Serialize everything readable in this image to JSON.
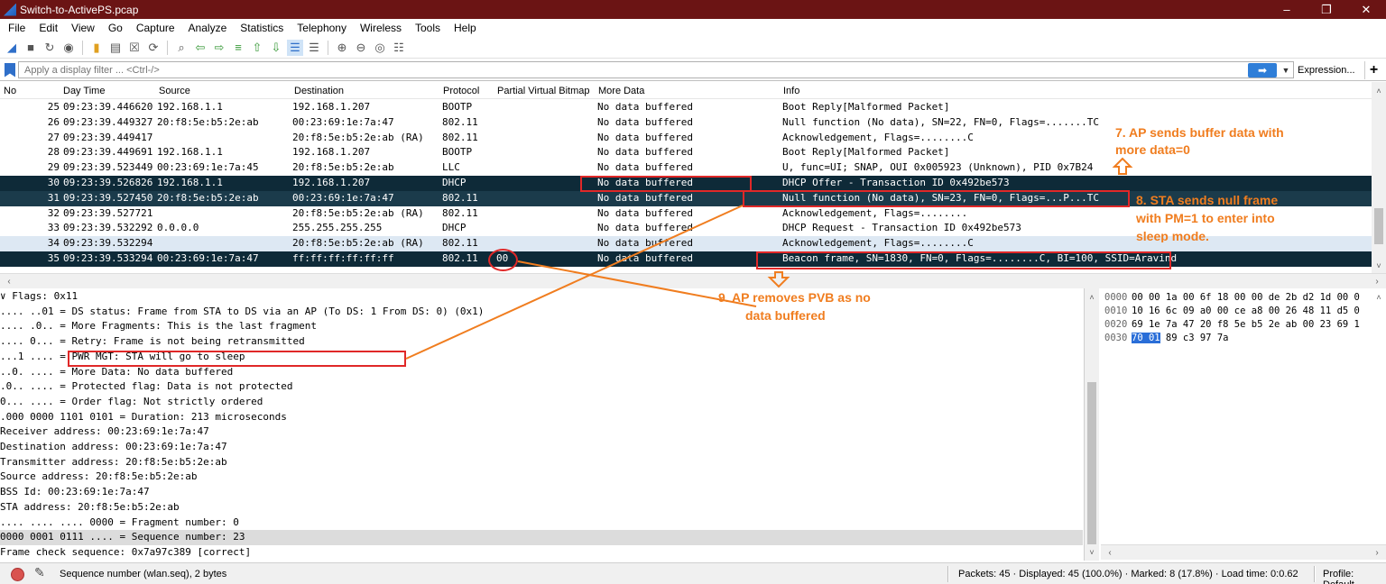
{
  "window": {
    "title": "Switch-to-ActivePS.pcap",
    "min_icon": "minimize-icon",
    "max_icon": "maximize-icon",
    "close_icon": "close-icon"
  },
  "menu": [
    "File",
    "Edit",
    "View",
    "Go",
    "Capture",
    "Analyze",
    "Statistics",
    "Telephony",
    "Wireless",
    "Tools",
    "Help"
  ],
  "filter": {
    "placeholder": "Apply a display filter ... <Ctrl-/>",
    "expression_label": "Expression...",
    "plus_label": "+"
  },
  "columns": {
    "no": "No",
    "time": "Day Time",
    "source": "Source",
    "destination": "Destination",
    "protocol": "Protocol",
    "pvb": "Partial Virtual Bitmap",
    "more_data": "More Data",
    "info": "Info"
  },
  "packets": [
    {
      "no": "25",
      "time": "09:23:39.446620",
      "source": "192.168.1.1",
      "destination": "192.168.1.207",
      "protocol": "BOOTP",
      "pvb": "",
      "more_data": "No data buffered",
      "info": "Boot Reply[Malformed Packet]"
    },
    {
      "no": "26",
      "time": "09:23:39.449327",
      "source": "20:f8:5e:b5:2e:ab",
      "destination": "00:23:69:1e:7a:47",
      "protocol": "802.11",
      "pvb": "",
      "more_data": "No data buffered",
      "info": "Null function (No data), SN=22, FN=0, Flags=.......TC"
    },
    {
      "no": "27",
      "time": "09:23:39.449417",
      "source": "",
      "destination": "20:f8:5e:b5:2e:ab (RA)",
      "protocol": "802.11",
      "pvb": "",
      "more_data": "No data buffered",
      "info": "Acknowledgement, Flags=........C"
    },
    {
      "no": "28",
      "time": "09:23:39.449691",
      "source": "192.168.1.1",
      "destination": "192.168.1.207",
      "protocol": "BOOTP",
      "pvb": "",
      "more_data": "No data buffered",
      "info": "Boot Reply[Malformed Packet]"
    },
    {
      "no": "29",
      "time": "09:23:39.523449",
      "source": "00:23:69:1e:7a:45",
      "destination": "20:f8:5e:b5:2e:ab",
      "protocol": "LLC",
      "pvb": "",
      "more_data": "No data buffered",
      "info": "U, func=UI; SNAP, OUI 0x005923 (Unknown), PID 0x7B24"
    },
    {
      "no": "30",
      "time": "09:23:39.526826",
      "source": "192.168.1.1",
      "destination": "192.168.1.207",
      "protocol": "DHCP",
      "pvb": "",
      "more_data": "No data buffered",
      "info": "DHCP Offer    - Transaction ID 0x492be573"
    },
    {
      "no": "31",
      "time": "09:23:39.527450",
      "source": "20:f8:5e:b5:2e:ab",
      "destination": "00:23:69:1e:7a:47",
      "protocol": "802.11",
      "pvb": "",
      "more_data": "No data buffered",
      "info": "Null function (No data), SN=23, FN=0, Flags=...P...TC"
    },
    {
      "no": "32",
      "time": "09:23:39.527721",
      "source": "",
      "destination": "20:f8:5e:b5:2e:ab (RA)",
      "protocol": "802.11",
      "pvb": "",
      "more_data": "No data buffered",
      "info": "Acknowledgement, Flags=........"
    },
    {
      "no": "33",
      "time": "09:23:39.532292",
      "source": "0.0.0.0",
      "destination": "255.255.255.255",
      "protocol": "DHCP",
      "pvb": "",
      "more_data": "No data buffered",
      "info": "DHCP Request  - Transaction ID 0x492be573"
    },
    {
      "no": "34",
      "time": "09:23:39.532294",
      "source": "",
      "destination": "20:f8:5e:b5:2e:ab (RA)",
      "protocol": "802.11",
      "pvb": "",
      "more_data": "No data buffered",
      "info": "Acknowledgement, Flags=........C"
    },
    {
      "no": "35",
      "time": "09:23:39.533294",
      "source": "00:23:69:1e:7a:47",
      "destination": "ff:ff:ff:ff:ff:ff",
      "protocol": "802.11",
      "pvb": "00",
      "more_data": "No data buffered",
      "info": "Beacon frame, SN=1830, FN=0, Flags=........C, BI=100, SSID=Aravind"
    }
  ],
  "details": [
    "  ∨ Flags: 0x11",
    "        .... ..01 = DS status: Frame from STA to DS via an AP (To DS: 1 From DS: 0) (0x1)",
    "        .... .0.. = More Fragments: This is the last fragment",
    "        .... 0... = Retry: Frame is not being retransmitted",
    "        ...1 .... = PWR MGT: STA will go to sleep",
    "        ..0. .... = More Data: No data buffered",
    "        .0.. .... = Protected flag: Data is not protected",
    "        0... .... = Order flag: Not strictly ordered",
    "  .000 0000 1101 0101 = Duration: 213 microseconds",
    "  Receiver address: 00:23:69:1e:7a:47",
    "  Destination address: 00:23:69:1e:7a:47",
    "  Transmitter address: 20:f8:5e:b5:2e:ab",
    "  Source address: 20:f8:5e:b5:2e:ab",
    "  BSS Id: 00:23:69:1e:7a:47",
    "  STA address: 20:f8:5e:b5:2e:ab",
    "  .... .... .... 0000 = Fragment number: 0",
    "  0000 0001 0111 .... = Sequence number: 23",
    "  Frame check sequence: 0x7a97c389 [correct]"
  ],
  "bytes": [
    {
      "offset": "0000",
      "hex": "00 00 1a 00 6f 18 00 00  de 2b d2 1d 00 0"
    },
    {
      "offset": "0010",
      "hex": "10 16 6c 09 a0 00 ce a8  00 26 48 11 d5 0"
    },
    {
      "offset": "0020",
      "hex": "69 1e 7a 47 20 f8 5e b5  2e ab 00 23 69 1"
    },
    {
      "offset": "0030",
      "hex_hl": "70 01",
      "hex_rest": " 89 c3 97 7a"
    }
  ],
  "status": {
    "field": "Sequence number (wlan.seq), 2 bytes",
    "packets": "Packets: 45 · Displayed: 45 (100.0%) · Marked: 8 (17.8%) · Load time: 0:0.62",
    "profile": "Profile: Default"
  },
  "annotations": {
    "a7_line1": "7. AP sends buffer data with",
    "a7_line2": "more data=0",
    "a8_line1": "8. STA sends null frame",
    "a8_line2": "with PM=1 to enter into",
    "a8_line3": "sleep mode.",
    "a9_line1": "9.   AP removes PVB as no",
    "a9_line2": "data buffered"
  },
  "colors": {
    "accent_annotation": "#f07d1f",
    "highlight_box": "#e02828",
    "selected_row": "#0e2a38",
    "titlebar": "#6b1414"
  }
}
